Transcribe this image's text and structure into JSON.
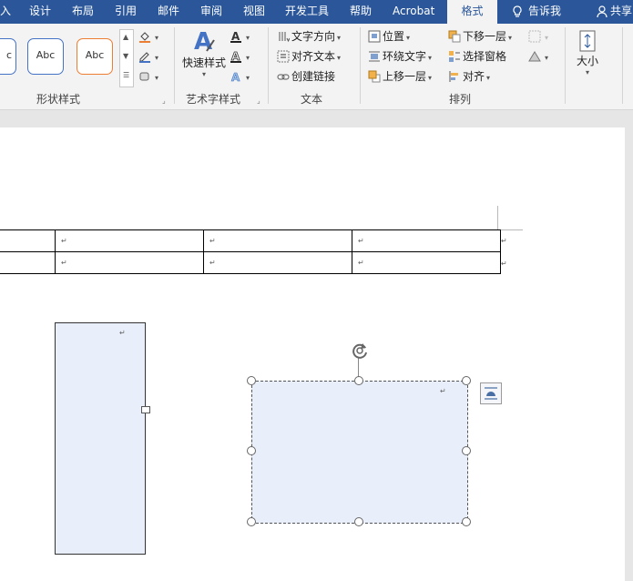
{
  "tabs": [
    {
      "label": "入",
      "active": false
    },
    {
      "label": "设计",
      "active": false
    },
    {
      "label": "布局",
      "active": false
    },
    {
      "label": "引用",
      "active": false
    },
    {
      "label": "邮件",
      "active": false
    },
    {
      "label": "审阅",
      "active": false
    },
    {
      "label": "视图",
      "active": false
    },
    {
      "label": "开发工具",
      "active": false
    },
    {
      "label": "帮助",
      "active": false
    },
    {
      "label": "Acrobat",
      "active": false
    },
    {
      "label": "格式",
      "active": true
    },
    {
      "label": "告诉我",
      "active": false
    },
    {
      "label": "共享",
      "active": false
    }
  ],
  "ribbon": {
    "shape_styles": {
      "label": "形状样式",
      "thumbs": [
        "c",
        "Abc",
        "Abc"
      ]
    },
    "wordart": {
      "label": "艺术字样式",
      "quick_styles": "快速样式"
    },
    "text": {
      "label": "文本",
      "direction": "文字方向",
      "align": "对齐文本",
      "link": "创建链接"
    },
    "arrange": {
      "label": "排列",
      "position": "位置",
      "wrap": "环绕文字",
      "forward": "上移一层",
      "backward": "下移一层",
      "pane": "选择窗格",
      "align": "对齐"
    },
    "size": {
      "label": "大小"
    }
  },
  "document": {
    "table": {
      "rows": [
        [
          "",
          "↵",
          "↵",
          "↵"
        ],
        [
          "",
          "↵",
          "↵",
          "↵"
        ]
      ],
      "row_end_mark": "↵"
    },
    "shape_mark": "↵"
  },
  "colors": {
    "accent": "#2b579a",
    "shape_fill": "#e8eefa",
    "ribbon_bg": "#f3f3f3"
  }
}
